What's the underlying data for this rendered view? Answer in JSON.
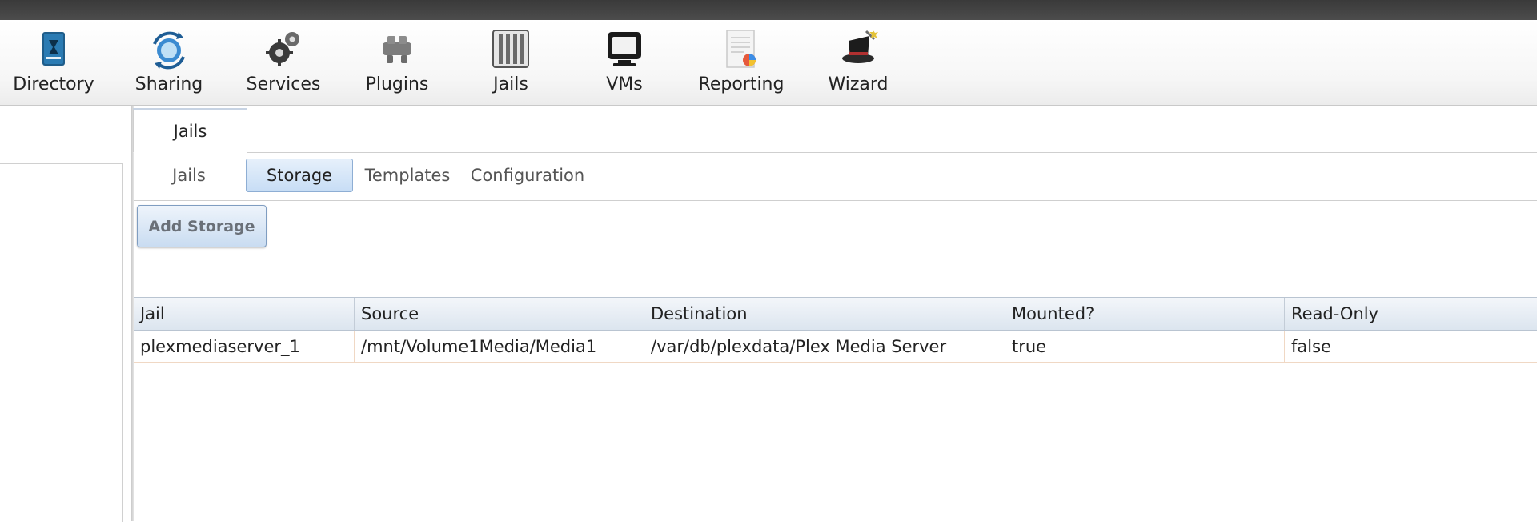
{
  "toolbar": {
    "items": [
      {
        "label": "Directory",
        "icon": "directory-icon"
      },
      {
        "label": "Sharing",
        "icon": "sharing-icon"
      },
      {
        "label": "Services",
        "icon": "services-icon"
      },
      {
        "label": "Plugins",
        "icon": "plugins-icon"
      },
      {
        "label": "Jails",
        "icon": "jails-icon"
      },
      {
        "label": "VMs",
        "icon": "vms-icon"
      },
      {
        "label": "Reporting",
        "icon": "reporting-icon"
      },
      {
        "label": "Wizard",
        "icon": "wizard-icon"
      }
    ]
  },
  "main_tab": {
    "label": "Jails"
  },
  "sub_tabs": {
    "items": [
      {
        "label": "Jails",
        "active": false
      },
      {
        "label": "Storage",
        "active": true
      },
      {
        "label": "Templates",
        "active": false
      },
      {
        "label": "Configuration",
        "active": false
      }
    ]
  },
  "actions": {
    "add_storage_label": "Add Storage"
  },
  "grid": {
    "columns": [
      "Jail",
      "Source",
      "Destination",
      "Mounted?",
      "Read-Only"
    ],
    "rows": [
      [
        "plexmediaserver_1",
        "/mnt/Volume1Media/Media1",
        "/var/db/plexdata/Plex Media Server",
        "true",
        "false"
      ]
    ]
  },
  "colors": {
    "topbar": "#3a3a3a",
    "active_tab": "#c7ddf5",
    "button_border": "#7f9dc1"
  }
}
